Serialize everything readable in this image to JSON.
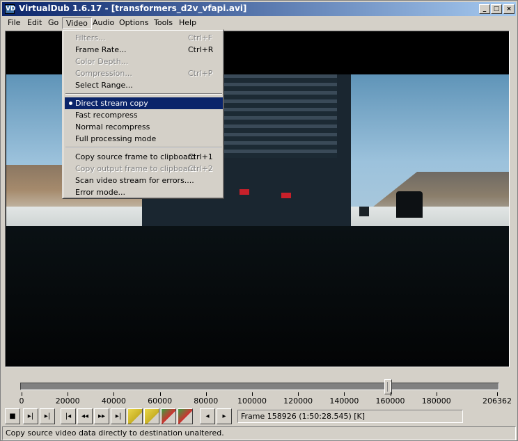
{
  "window": {
    "title": "VirtualDub 1.6.17 - [transformers_d2v_vfapi.avi]",
    "app_icon": "VD",
    "controls": [
      "_",
      "□",
      "×"
    ]
  },
  "menubar": [
    "File",
    "Edit",
    "Go",
    "Video",
    "Audio",
    "Options",
    "Tools",
    "Help"
  ],
  "video_menu": {
    "items": [
      {
        "label": "Filters...",
        "shortcut": "Ctrl+F",
        "disabled": true
      },
      {
        "label": "Frame Rate...",
        "shortcut": "Ctrl+R",
        "disabled": false
      },
      {
        "label": "Color Depth...",
        "shortcut": "",
        "disabled": true
      },
      {
        "label": "Compression...",
        "shortcut": "Ctrl+P",
        "disabled": true
      },
      {
        "label": "Select Range...",
        "shortcut": "",
        "disabled": false
      },
      {
        "label": "Direct stream copy",
        "shortcut": "",
        "checked": true,
        "highlighted": true
      },
      {
        "label": "Fast recompress",
        "shortcut": ""
      },
      {
        "label": "Normal recompress",
        "shortcut": ""
      },
      {
        "label": "Full processing mode",
        "shortcut": ""
      },
      {
        "label": "Copy source frame to clipboard",
        "shortcut": "Ctrl+1",
        "disabled": false
      },
      {
        "label": "Copy output frame to clipboard",
        "shortcut": "Ctrl+2",
        "disabled": true
      },
      {
        "label": "Scan video stream for errors....",
        "shortcut": ""
      },
      {
        "label": "Error mode...",
        "shortcut": ""
      }
    ]
  },
  "timeline": {
    "tick_labels": [
      "0",
      "20000",
      "40000",
      "60000",
      "80000",
      "100000",
      "120000",
      "140000",
      "160000",
      "180000",
      "206362"
    ],
    "total_frames": 206362,
    "current_frame": 158926
  },
  "toolbar": {
    "buttons": [
      "stop-icon",
      "play-input-icon",
      "play-output-icon",
      "go-start-icon",
      "step-back-icon",
      "step-forward-icon",
      "go-end-icon",
      "prev-keyframe-icon",
      "next-keyframe-icon",
      "scene-back-icon",
      "scene-forward-icon",
      "mark-in-icon",
      "mark-out-icon"
    ],
    "glyphs": [
      "■",
      "▸|",
      "▸|",
      "|◂",
      "◂◂",
      "▸▸",
      "▸|",
      "",
      "",
      "",
      "",
      "◂",
      "▸"
    ],
    "frame_status": "Frame 158926 (1:50:28.545) [K]"
  },
  "statusbar": {
    "text": "Copy source video data directly to destination unaltered."
  }
}
